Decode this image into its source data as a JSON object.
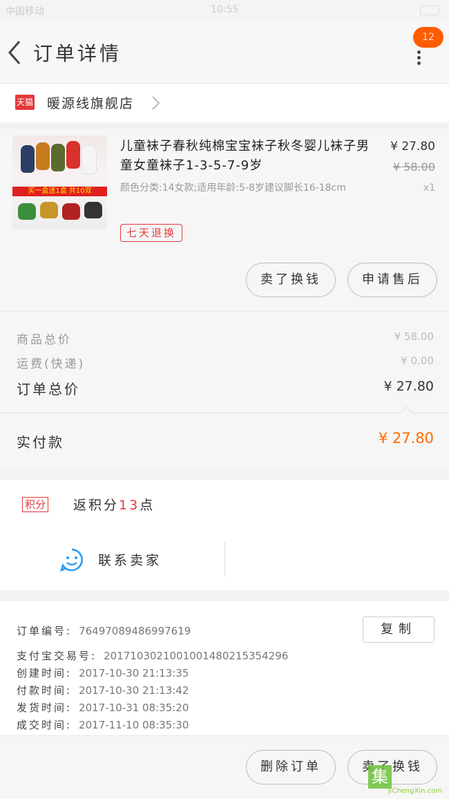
{
  "status_bar": {
    "left": "中国移动",
    "time": "10:55"
  },
  "header": {
    "title": "订单详情",
    "badge": "12"
  },
  "shop": {
    "badge": "天猫",
    "name": "暖源线旗舰店"
  },
  "product": {
    "thumb_banner": "买一盒送1盒 共10双",
    "name": "儿童袜子春秋纯棉宝宝袜子秋冬婴儿袜子男童女童袜子1-3-5-7-9岁",
    "spec": "颜色分类:14女款;适用年龄:5-8岁建议脚长16-18cm",
    "price": "¥ 27.80",
    "original_price": "¥ 58.00",
    "quantity": "x1",
    "tag": "七天退换",
    "buttons": [
      "卖了换钱",
      "申请售后"
    ]
  },
  "totals": {
    "goods_label": "商品总价",
    "goods_value": "¥ 58.00",
    "shipping_label": "运费(快递)",
    "shipping_value": "¥ 0.00",
    "order_label": "订单总价",
    "order_value": "¥ 27.80",
    "paid_label": "实付款",
    "paid_value": "¥ 27.80"
  },
  "points": {
    "badge": "积分",
    "text_pre": "返积分",
    "num": "13",
    "text_post": "点"
  },
  "contact": {
    "label": "联系卖家"
  },
  "info": {
    "copy_label": "复制",
    "rows": [
      {
        "k": "订单编号:",
        "v": "76497089486997619"
      },
      {
        "k": "支付宝交易号:",
        "v": "2017103021001001480215354296"
      },
      {
        "k": "创建时间:",
        "v": "2017-10-30 21:13:35"
      },
      {
        "k": "付款时间:",
        "v": "2017-10-30 21:13:42"
      },
      {
        "k": "发货时间:",
        "v": "2017-10-31 08:35:20"
      },
      {
        "k": "成交时间:",
        "v": "2017-11-10 08:35:30"
      }
    ]
  },
  "bottom": {
    "buttons": [
      "删除订单",
      "卖了换钱"
    ]
  },
  "watermark": {
    "text": "JiChengXin.com",
    "glyph": "集"
  },
  "colors": {
    "accent": "#ff5c00",
    "tmall_red": "#e4393c",
    "paid": "#ff6a00"
  }
}
